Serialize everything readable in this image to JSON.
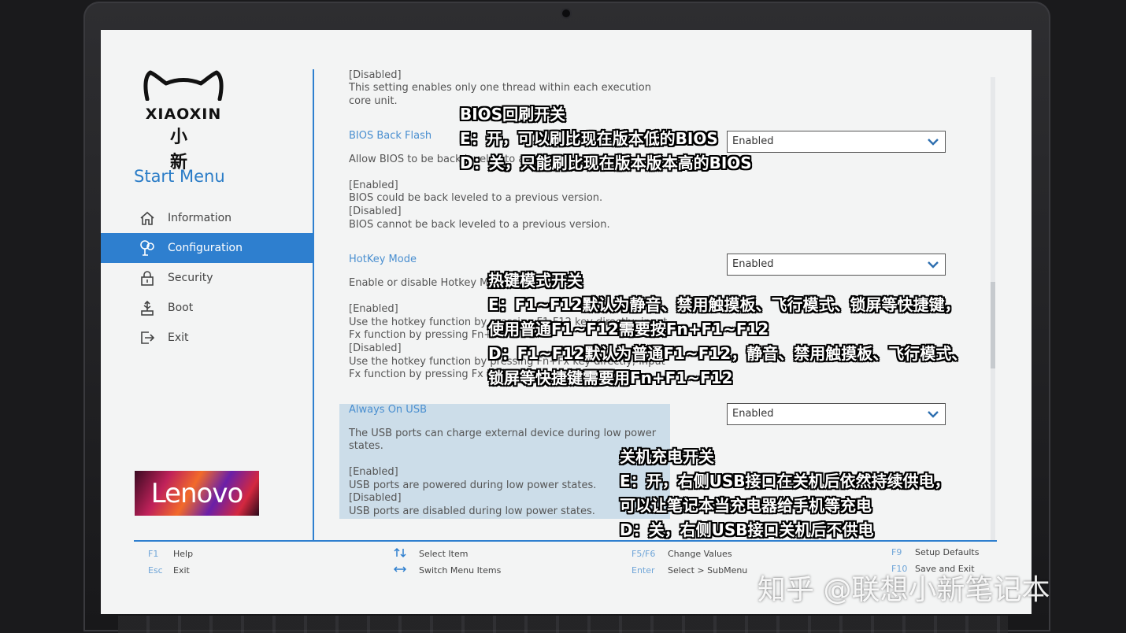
{
  "brand": {
    "logo_word": "XIAOXIN",
    "logo_cn": "小新",
    "badge": "Lenovo"
  },
  "sidebar": {
    "title": "Start Menu",
    "items": [
      {
        "label": "Information",
        "icon": "home-icon",
        "active": false
      },
      {
        "label": "Configuration",
        "icon": "configuration-icon",
        "active": true
      },
      {
        "label": "Security",
        "icon": "lock-icon",
        "active": false
      },
      {
        "label": "Boot",
        "icon": "usb-icon",
        "active": false
      },
      {
        "label": "Exit",
        "icon": "exit-icon",
        "active": false
      }
    ]
  },
  "main": {
    "prev_setting": {
      "tail_disabled": "[Disabled]",
      "desc1": "This setting enables only one thread within each execution",
      "desc2": "core unit."
    },
    "bios_back_flash": {
      "title": "BIOS Back Flash",
      "value": "Enabled",
      "desc": "Allow BIOS to be back leveled to a previous version.",
      "enabled_tag": "[Enabled]",
      "enabled_desc": "BIOS could be back leveled to a previous version.",
      "disabled_tag": "[Disabled]",
      "disabled_desc": "BIOS cannot be back leveled to a previous version."
    },
    "hotkey_mode": {
      "title": "HotKey Mode",
      "value": "Enabled",
      "desc": "Enable or disable Hotkey Mode.",
      "enabled_tag": "[Enabled]",
      "enabled_desc1": "Use the hotkey function by pressing F1-F12 key directly; input",
      "enabled_desc2": "Fx function by pressing Fn+Fx.",
      "disabled_tag": "[Disabled]",
      "disabled_desc1": "Use the hotkey function by pressing Fn+Fx key directly; input",
      "disabled_desc2": "Fx function by pressing Fx key."
    },
    "always_on_usb": {
      "title": "Always On USB",
      "value": "Enabled",
      "desc1": "The USB ports can charge external device during low power",
      "desc2": "states.",
      "enabled_tag": "[Enabled]",
      "enabled_desc": "USB ports are powered during low power states.",
      "disabled_tag": "[Disabled]",
      "disabled_desc": "USB ports are disabled during low power states."
    }
  },
  "footer": {
    "f1_key": "F1",
    "f1_label": "Help",
    "esc_key": "Esc",
    "esc_label": "Exit",
    "updown_label": "Select Item",
    "leftright_label": "Switch Menu Items",
    "f5f6_key": "F5/F6",
    "f5f6_label": "Change Values",
    "enter_key": "Enter",
    "enter_label": "Select > SubMenu",
    "f9_key": "F9",
    "f9_label": "Setup Defaults",
    "f10_key": "F10",
    "f10_label": "Save and Exit"
  },
  "captions": {
    "bios": [
      "BIOS回刷开关",
      "E：开，可以刷比现在版本低的BIOS",
      "D：关，只能刷比现在版本版本高的BIOS"
    ],
    "hotkey": [
      "热键模式开关",
      "E：F1~F12默认为静音、禁用触摸板、飞行模式、锁屏等快捷键，",
      "使用普通F1~F12需要按Fn+F1~F12",
      "D：F1~F12默认为普通F1~F12，静音、禁用触摸板、飞行模式、",
      "锁屏等快捷键需要用Fn+F1~F12"
    ],
    "usb": [
      "关机充电开关",
      "E：开，右侧USB接口在关机后依然持续供电，",
      "可以让笔记本当充电器给手机等充电",
      "D：关，右侧USB接口关机后不供电"
    ]
  },
  "watermark": "知乎 @联想小新笔记本",
  "colors": {
    "accent": "#2e7fcf",
    "title_blue": "#4a8fd0",
    "highlight": "#ccdde9"
  }
}
